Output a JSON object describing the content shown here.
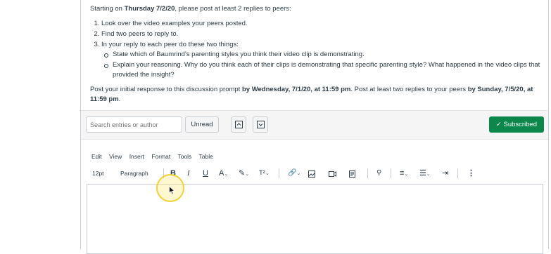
{
  "prompt": {
    "starting_prefix": "Starting on ",
    "starting_date": "Thursday 7/2/20",
    "starting_suffix": ", please post at least 2 replies to peers:",
    "steps": [
      "Look over the video examples your peers posted.",
      "Find two peers to reply to.",
      "In your reply to each peer do these two things:"
    ],
    "substeps": [
      "State which of Baumrind's parenting styles you think their video clip is demonstrating.",
      "Explain your reasoning. Why do you think each of their clips is demonstrating that specific parenting style? What happened in the video clips that provided the insight?"
    ],
    "post_prefix": "Post your initial response to this discussion prompt ",
    "post_deadline1": "by Wednesday, 7/1/20, at 11:59 pm",
    "post_middle": ". Post at least two replies to your peers ",
    "post_deadline2": "by Sunday, 7/5/20, at 11:59 pm",
    "post_end": "."
  },
  "discussion_toolbar": {
    "search_placeholder": "Search entries or author",
    "unread_label": "Unread",
    "subscribed_label": "Subscribed",
    "subscribed_color": "#0b874b"
  },
  "editor": {
    "menu": [
      "Edit",
      "View",
      "Insert",
      "Format",
      "Tools",
      "Table"
    ],
    "font_size": "12pt",
    "block_format": "Paragraph",
    "superscript_label": "T²"
  },
  "icons": [
    "check-icon",
    "collapse-up-icon",
    "expand-down-icon",
    "bold-icon",
    "italic-icon",
    "underline-icon",
    "text-color-icon",
    "highlight-icon",
    "superscript-icon",
    "link-icon",
    "image-icon",
    "media-icon",
    "document-icon",
    "apps-icon",
    "align-icon",
    "bullet-list-icon",
    "indent-icon",
    "more-icon",
    "mouse-pointer-icon"
  ]
}
